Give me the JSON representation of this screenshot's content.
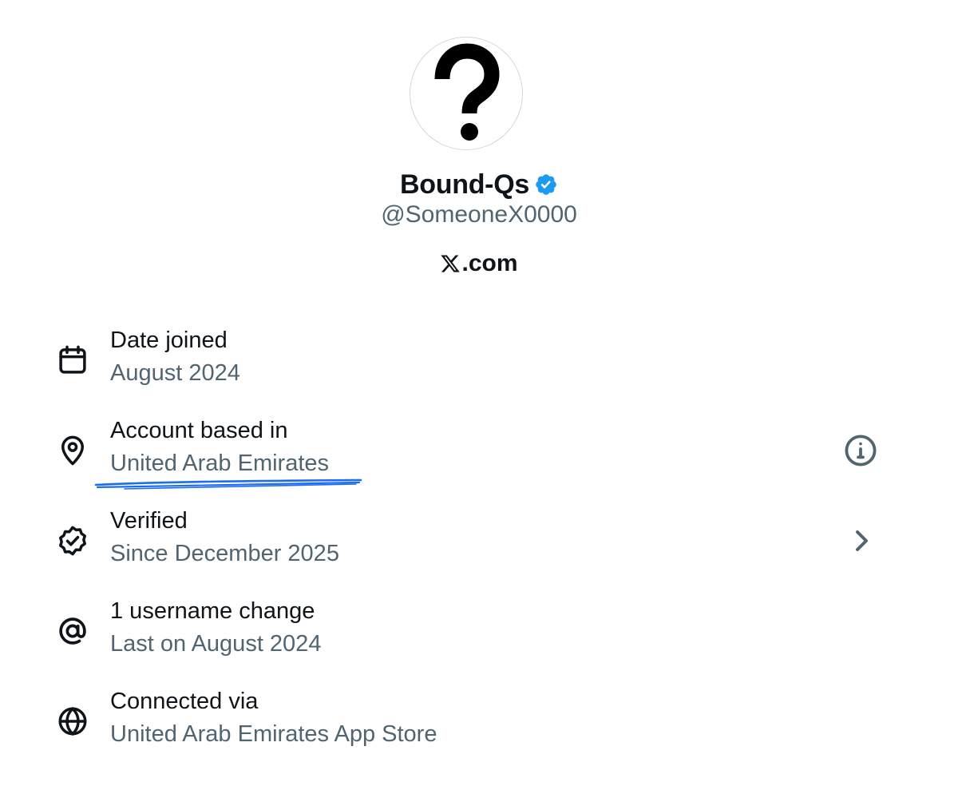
{
  "profile": {
    "display_name": "Bound-Qs",
    "handle": "@SomeoneX0000",
    "site": ".com",
    "site_logo_icon": "x-logo-icon",
    "avatar_icon": "question-mark-icon",
    "verified_badge_color": "#1d9bf0"
  },
  "colors": {
    "primary_text": "#0f1419",
    "secondary_text": "#536471",
    "annotation_underline": "#1d6cf2"
  },
  "about_rows": [
    {
      "icon": "calendar-icon",
      "title": "Date joined",
      "subtitle": "August 2024"
    },
    {
      "icon": "location-pin-icon",
      "title": "Account based in",
      "subtitle": "United Arab Emirates",
      "action_icon": "info-icon"
    },
    {
      "icon": "verified-badge-icon",
      "title": "Verified",
      "subtitle": "Since December 2025",
      "action_icon": "chevron-right-icon"
    },
    {
      "icon": "at-sign-icon",
      "title": "1 username change",
      "subtitle": "Last on August 2024"
    },
    {
      "icon": "globe-icon",
      "title": "Connected via",
      "subtitle": "United Arab Emirates App Store"
    }
  ]
}
